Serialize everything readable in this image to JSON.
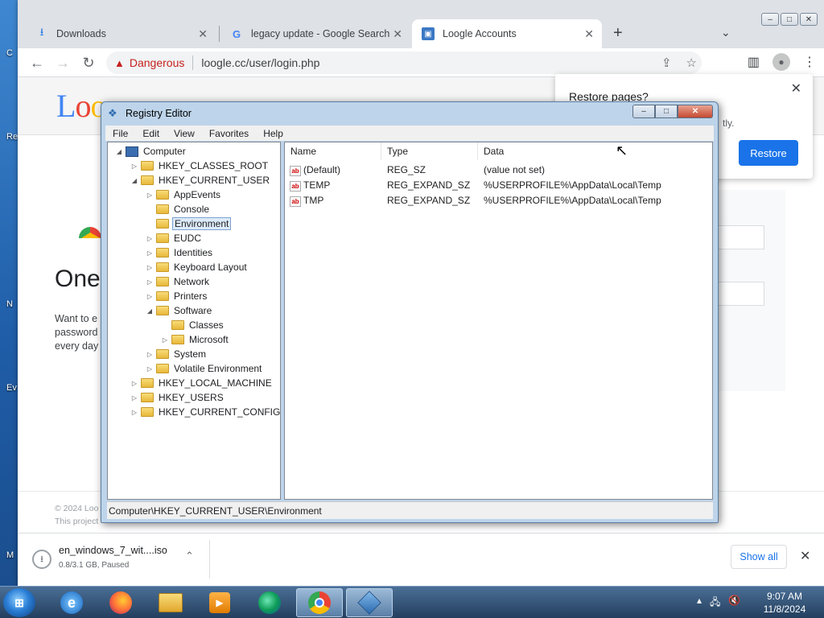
{
  "browser": {
    "tabs": [
      {
        "label": "Downloads",
        "icon": "download-icon"
      },
      {
        "label": "legacy update - Google Search",
        "icon": "google-icon"
      },
      {
        "label": "Loogle Accounts",
        "icon": "loogle-icon"
      }
    ],
    "security_label": "Dangerous",
    "url": "loogle.cc/user/login.php"
  },
  "page": {
    "logo_text": "Loogle",
    "heading": "One",
    "body_lines": [
      "Want to e",
      "password",
      "every day"
    ],
    "footer_lines": [
      "© 2024 Loo",
      "This project"
    ]
  },
  "restore_popup": {
    "title": "Restore pages?",
    "subtitle": "tly.",
    "button": "Restore"
  },
  "download_bar": {
    "file_name": "en_windows_7_wit....iso",
    "status": "0.8/3.1 GB, Paused",
    "show_all": "Show all"
  },
  "registry_editor": {
    "title": "Registry Editor",
    "menu": [
      "File",
      "Edit",
      "View",
      "Favorites",
      "Help"
    ],
    "tree": [
      {
        "label": "Computer",
        "level": 0,
        "expanded": true
      },
      {
        "label": "HKEY_CLASSES_ROOT",
        "level": 1,
        "expanded": false
      },
      {
        "label": "HKEY_CURRENT_USER",
        "level": 1,
        "expanded": true
      },
      {
        "label": "AppEvents",
        "level": 2,
        "expanded": false
      },
      {
        "label": "Console",
        "level": 2,
        "expanded": null
      },
      {
        "label": "Environment",
        "level": 2,
        "expanded": null,
        "selected": true
      },
      {
        "label": "EUDC",
        "level": 2,
        "expanded": false
      },
      {
        "label": "Identities",
        "level": 2,
        "expanded": false
      },
      {
        "label": "Keyboard Layout",
        "level": 2,
        "expanded": false
      },
      {
        "label": "Network",
        "level": 2,
        "expanded": false
      },
      {
        "label": "Printers",
        "level": 2,
        "expanded": false
      },
      {
        "label": "Software",
        "level": 2,
        "expanded": true
      },
      {
        "label": "Classes",
        "level": 3,
        "expanded": null
      },
      {
        "label": "Microsoft",
        "level": 3,
        "expanded": false
      },
      {
        "label": "System",
        "level": 2,
        "expanded": false
      },
      {
        "label": "Volatile Environment",
        "level": 2,
        "expanded": false
      },
      {
        "label": "HKEY_LOCAL_MACHINE",
        "level": 1,
        "expanded": false
      },
      {
        "label": "HKEY_USERS",
        "level": 1,
        "expanded": false
      },
      {
        "label": "HKEY_CURRENT_CONFIG",
        "level": 1,
        "expanded": false
      }
    ],
    "columns": [
      "Name",
      "Type",
      "Data"
    ],
    "values": [
      {
        "name": "(Default)",
        "type": "REG_SZ",
        "data": "(value not set)"
      },
      {
        "name": "TEMP",
        "type": "REG_EXPAND_SZ",
        "data": "%USERPROFILE%\\AppData\\Local\\Temp"
      },
      {
        "name": "TMP",
        "type": "REG_EXPAND_SZ",
        "data": "%USERPROFILE%\\AppData\\Local\\Temp"
      }
    ],
    "status_path": "Computer\\HKEY_CURRENT_USER\\Environment"
  },
  "taskbar": {
    "apps": [
      "internet-explorer-icon",
      "firefox-icon",
      "file-explorer-icon",
      "media-player-icon",
      "edge-icon",
      "chrome-icon",
      "registry-editor-icon"
    ],
    "time": "9:07 AM",
    "date": "11/8/2024"
  }
}
